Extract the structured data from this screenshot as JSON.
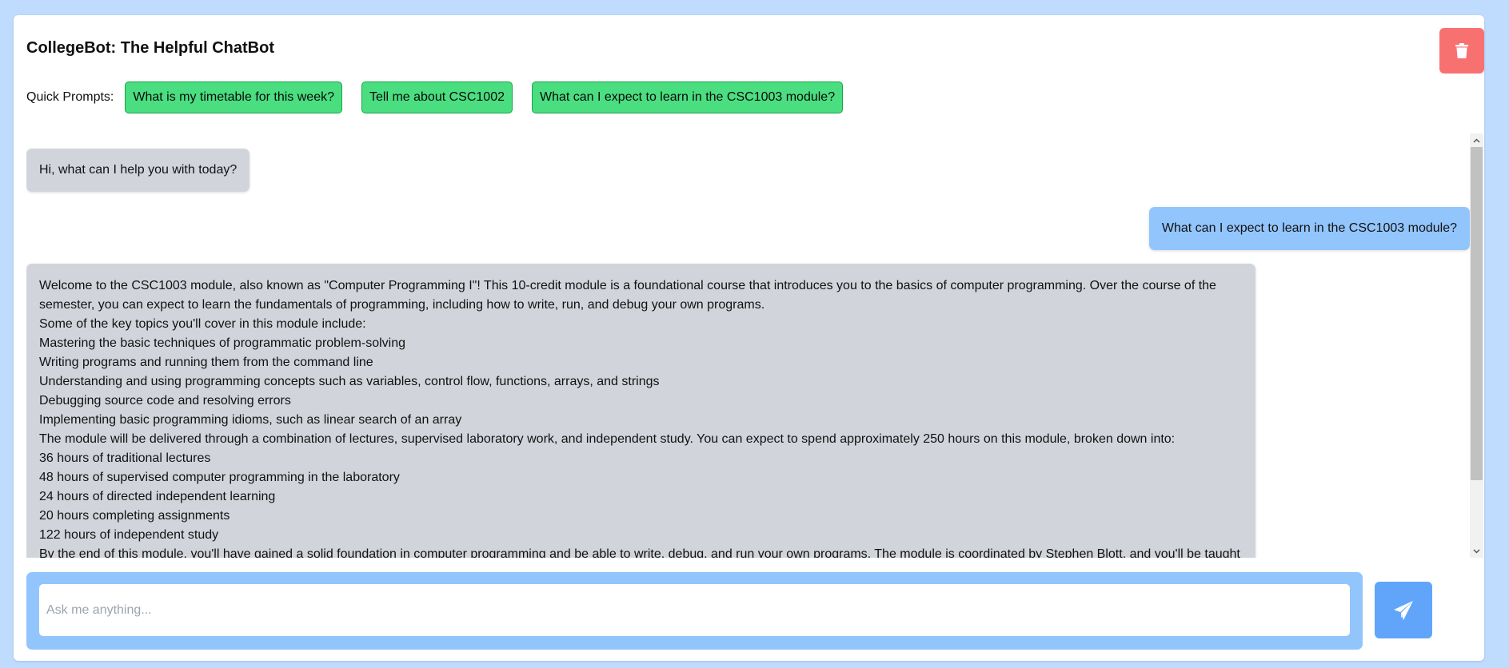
{
  "app": {
    "title": "CollegeBot: The Helpful ChatBot",
    "accent_colors": {
      "page_background": "#bfdbfe",
      "quick_prompt": "#4ade80",
      "bot_bubble": "#d1d5db",
      "user_bubble": "#93c5fd",
      "trash_button": "#f87171",
      "send_button": "#60a5fa"
    }
  },
  "header": {
    "trash_icon": "trash-icon"
  },
  "quick_prompts": {
    "label": "Quick Prompts:",
    "items": [
      {
        "label": "What is my timetable for this week?"
      },
      {
        "label": "Tell me about CSC1002"
      },
      {
        "label": "What can I expect to learn in the CSC1003 module?"
      }
    ]
  },
  "messages": [
    {
      "role": "bot",
      "text": "Hi, what can I help you with today?"
    },
    {
      "role": "user",
      "text": "What can I expect to learn in the CSC1003 module?"
    },
    {
      "role": "bot",
      "lines": [
        "Welcome to the CSC1003 module, also known as \"Computer Programming I\"! This 10-credit module is a foundational course that introduces you to the basics of computer programming. Over the course of the semester, you can expect to learn the fundamentals of programming, including how to write, run, and debug your own programs.",
        "Some of the key topics you'll cover in this module include:",
        "Mastering the basic techniques of programmatic problem-solving",
        "Writing programs and running them from the command line",
        "Understanding and using programming concepts such as variables, control flow, functions, arrays, and strings",
        "Debugging source code and resolving errors",
        "Implementing basic programming idioms, such as linear search of an array",
        "The module will be delivered through a combination of lectures, supervised laboratory work, and independent study. You can expect to spend approximately 250 hours on this module, broken down into:",
        "36 hours of traditional lectures",
        "48 hours of supervised computer programming in the laboratory",
        "24 hours of directed independent learning",
        "20 hours completing assignments",
        "122 hours of independent study",
        "By the end of this module, you'll have gained a solid foundation in computer programming and be able to write, debug, and run your own programs. The module is coordinated by Stephen Blott, and you'll be taught by Andrew Mccarren and Denise Freir."
      ]
    }
  ],
  "composer": {
    "placeholder": "Ask me anything...",
    "value": "",
    "send_icon": "paper-plane-icon"
  }
}
